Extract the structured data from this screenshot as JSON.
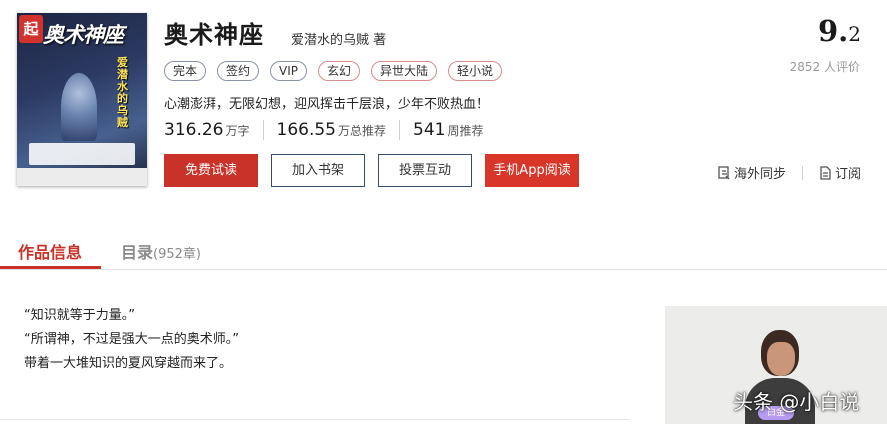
{
  "book": {
    "cover": {
      "logo_glyph": "起",
      "title_art": "奥术神座",
      "author_art": "爱潜水的乌贼"
    },
    "title": "奥术神座",
    "author": "爱潜水的乌贼 著",
    "tags": [
      {
        "label": "完本",
        "style": "plain"
      },
      {
        "label": "签约",
        "style": "plain"
      },
      {
        "label": "VIP",
        "style": "plain"
      },
      {
        "label": "玄幻",
        "style": "red"
      },
      {
        "label": "异世大陆",
        "style": "red"
      },
      {
        "label": "轻小说",
        "style": "red"
      }
    ],
    "intro": "心潮澎湃，无限幻想，迎风挥击千层浪，少年不败热血！",
    "stats": [
      {
        "value": "316.26",
        "unit": "万字"
      },
      {
        "value": "166.55",
        "unit": "万总推荐"
      },
      {
        "value": "541",
        "unit": "周推荐"
      }
    ],
    "actions": {
      "free_read": "免费试读",
      "add_shelf": "加入书架",
      "vote": "投票互动",
      "app_read": "手机App阅读"
    },
    "score": {
      "integer": "9.",
      "decimal": "2"
    },
    "rating_count": "2852 人评价",
    "side_links": {
      "sync": "海外同步",
      "subscribe": "订阅"
    }
  },
  "tabs": {
    "info": "作品信息",
    "toc": "目录",
    "toc_count": "(952章)"
  },
  "content": {
    "lines": [
      "“知识就等于力量。”",
      "“所谓神，不过是强大一点的奥术师。”",
      "带着一大堆知识的夏风穿越而来了。"
    ]
  },
  "author_card": {
    "badge": "白金"
  },
  "watermark": "头条 @小白说",
  "colors": {
    "accent_red": "#c83228",
    "tag_border": "#8a93a6",
    "tag_red_border": "#d58d8d",
    "muted": "#999999"
  },
  "icons": [
    "sync-icon",
    "subscribe-icon"
  ]
}
